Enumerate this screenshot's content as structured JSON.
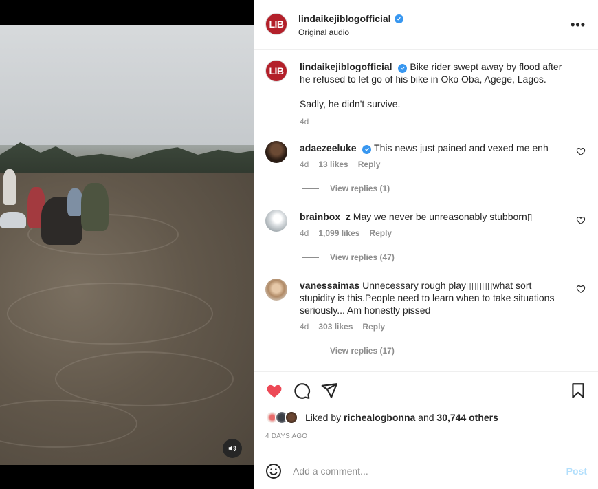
{
  "post": {
    "author": "lindaikejiblogofficial",
    "avatar_text": "LIB",
    "audio": "Original audio",
    "caption_lines": [
      "Bike rider swept away by flood after he refused to let go of his bike in Oko Oba, Agege, Lagos.",
      "Sadly, he didn't survive."
    ],
    "caption_time": "4d",
    "liked_by_user": "richealogbonna",
    "liked_by_others": "30,744 others",
    "liked_prefix": "Liked by",
    "liked_and": "and",
    "posted_ago": "4 DAYS AGO"
  },
  "comments": [
    {
      "user": "adaezeeluke",
      "verified": true,
      "text": "This news just pained and vexed me enh",
      "time": "4d",
      "likes": "13 likes",
      "reply": "Reply",
      "view_replies": "View replies (1)"
    },
    {
      "user": "brainbox_z",
      "verified": false,
      "text": "May we never be unreasonably stubborn▯",
      "time": "4d",
      "likes": "1,099 likes",
      "reply": "Reply",
      "view_replies": "View replies (47)"
    },
    {
      "user": "vanessaimas",
      "verified": false,
      "text": "Unnecessary rough play▯▯▯▯▯what sort stupidity is this.People need to learn when to take situations seriously... Am honestly pissed",
      "time": "4d",
      "likes": "303 likes",
      "reply": "Reply",
      "view_replies": "View replies (17)"
    }
  ],
  "composer": {
    "placeholder": "Add a comment...",
    "post_label": "Post"
  },
  "icons": {
    "more": "•••"
  },
  "colors": {
    "like_red": "#ed4956",
    "verified_blue": "#3897f0",
    "lib_red": "#b3202a",
    "post_disabled": "#b2dffc"
  }
}
